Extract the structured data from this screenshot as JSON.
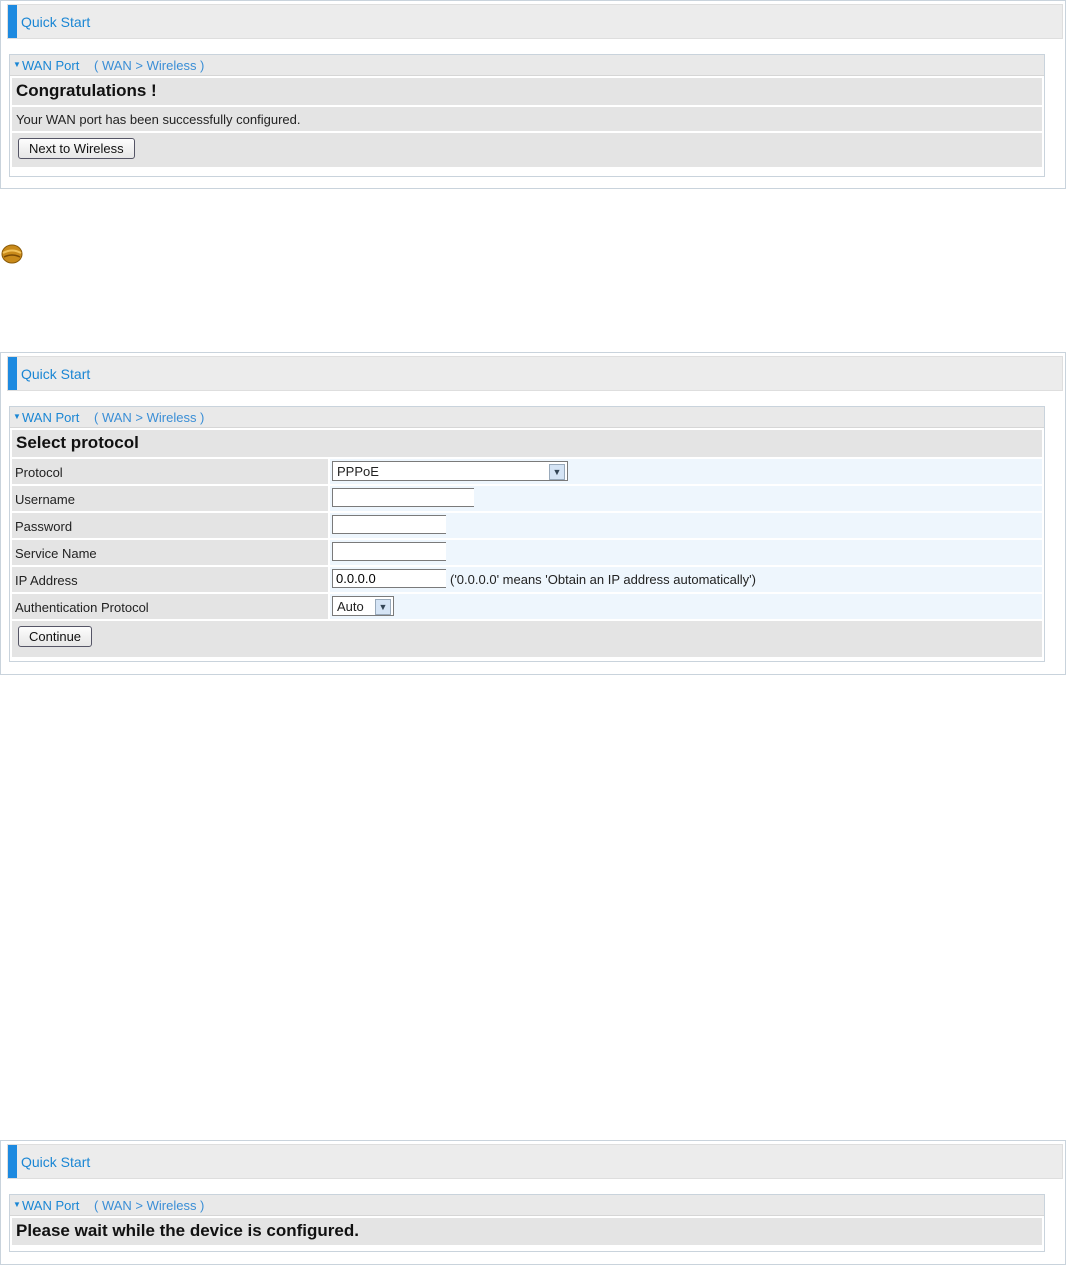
{
  "panel1": {
    "title": "Quick Start",
    "breadcrumb_section": "WAN Port",
    "breadcrumb_path": "( WAN  >  Wireless )",
    "heading": "Congratulations !",
    "message": "Your WAN port has been successfully configured.",
    "next_button": "Next to Wireless"
  },
  "panel2": {
    "title": "Quick Start",
    "breadcrumb_section": "WAN Port",
    "breadcrumb_path": "( WAN  >  Wireless )",
    "heading": "Select protocol",
    "fields": {
      "protocol_label": "Protocol",
      "protocol_value": "PPPoE",
      "username_label": "Username",
      "username_value": "",
      "password_label": "Password",
      "password_value": "",
      "service_label": "Service Name",
      "service_value": "",
      "ip_label": "IP Address",
      "ip_value": "0.0.0.0",
      "ip_hint": "('0.0.0.0' means 'Obtain an IP address automatically')",
      "auth_label": "Authentication Protocol",
      "auth_value": "Auto"
    },
    "continue_button": "Continue"
  },
  "panel3": {
    "title": "Quick Start",
    "breadcrumb_section": "WAN Port",
    "breadcrumb_path": "( WAN  >  Wireless )",
    "heading": "Please wait while the device is configured."
  },
  "colors": {
    "accent": "#1d8ae0",
    "link": "#1a86d4",
    "field_bg": "#eef6fd",
    "row_bg": "#e4e4e4"
  },
  "icons": {
    "bullet": "bullet-ball-icon",
    "crumb": "triangle-down-icon",
    "dropdown": "chevron-down-icon"
  }
}
